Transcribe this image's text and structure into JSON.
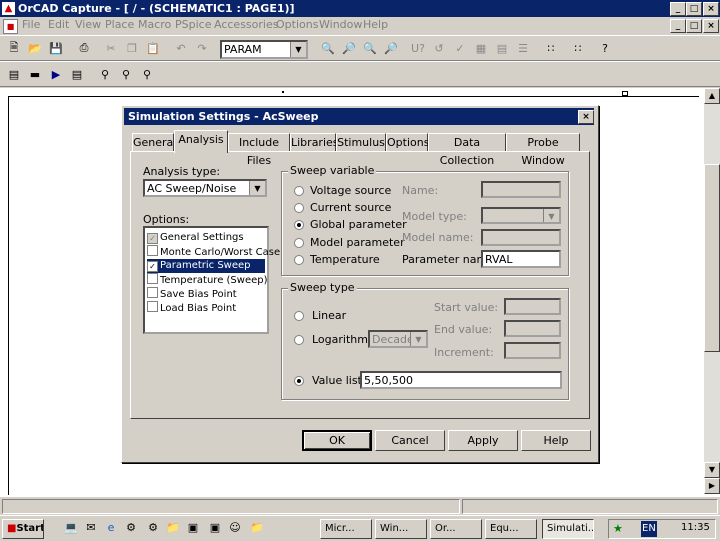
{
  "window": {
    "title": "OrCAD Capture - [ / - (SCHEMATIC1 : PAGE1)]"
  },
  "menu": [
    "File",
    "Edit",
    "View",
    "Place",
    "Macro",
    "PSpice",
    "Accessories",
    "Options",
    "Window",
    "Help"
  ],
  "toolbar": {
    "part_combo_value": "PARAM"
  },
  "dialog": {
    "title": "Simulation Settings - AcSweep",
    "tabs": [
      "General",
      "Analysis",
      "Include Files",
      "Libraries",
      "Stimulus",
      "Options",
      "Data Collection",
      "Probe Window"
    ],
    "active_tab": "Analysis",
    "analysis_type_label": "Analysis type:",
    "analysis_type_value": "AC Sweep/Noise",
    "options_label": "Options:",
    "options": [
      {
        "label": "General Settings",
        "checked": true,
        "grayed": true,
        "selected": false
      },
      {
        "label": "Monte Carlo/Worst Case",
        "checked": false,
        "grayed": false,
        "selected": false
      },
      {
        "label": "Parametric Sweep",
        "checked": true,
        "grayed": false,
        "selected": true
      },
      {
        "label": "Temperature (Sweep)",
        "checked": false,
        "grayed": false,
        "selected": false
      },
      {
        "label": "Save Bias Point",
        "checked": false,
        "grayed": false,
        "selected": false
      },
      {
        "label": "Load Bias Point",
        "checked": false,
        "grayed": false,
        "selected": false
      }
    ],
    "sweep_variable": {
      "group_label": "Sweep variable",
      "radios": [
        "Voltage source",
        "Current source",
        "Global parameter",
        "Model parameter",
        "Temperature"
      ],
      "selected": "Global parameter",
      "name_label": "Name:",
      "model_type_label": "Model type:",
      "model_name_label": "Model name:",
      "parameter_name_label": "Parameter name:",
      "parameter_name_value": "RVAL"
    },
    "sweep_type": {
      "group_label": "Sweep type",
      "linear_label": "Linear",
      "log_label": "Logarithmic",
      "log_combo_value": "Decade",
      "start_label": "Start value:",
      "end_label": "End value:",
      "increment_label": "Increment:",
      "value_list_label": "Value list",
      "value_list_value": "5,50,500"
    },
    "buttons": {
      "ok": "OK",
      "cancel": "Cancel",
      "apply": "Apply",
      "help": "Help"
    }
  },
  "taskbar": {
    "start": "Start",
    "tasks": [
      "Micr...",
      "Win...",
      "Or...",
      "Equ...",
      "Simulati..."
    ],
    "tray_lang": "EN",
    "clock": "11:35"
  }
}
